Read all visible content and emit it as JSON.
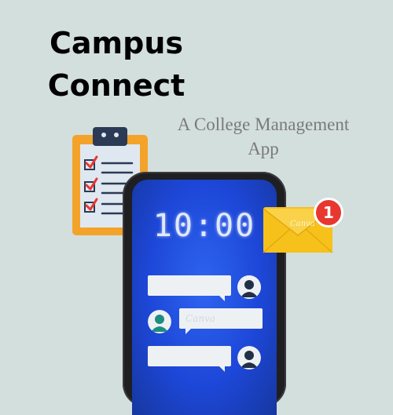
{
  "header": {
    "title_line1": "Campus",
    "title_line2": "Connect",
    "subtitle_line1": "A College Management",
    "subtitle_line2": "App"
  },
  "phone": {
    "clock": "10:00",
    "messages": [
      {
        "side": "right",
        "text": ""
      },
      {
        "side": "left",
        "text": "Canva"
      },
      {
        "side": "right",
        "text": ""
      }
    ]
  },
  "notification": {
    "badge_count": "1",
    "envelope_watermark": "Canva"
  },
  "colors": {
    "background": "#d3dfdd",
    "screen_blue": "#1d47d8",
    "clipboard_orange": "#f4a32a",
    "envelope_yellow": "#f7c11c",
    "badge_red": "#e8372f",
    "avatar_teal": "#1e8c80",
    "avatar_navy": "#213046"
  },
  "icons": [
    "clipboard-checklist-icon",
    "envelope-icon",
    "notification-badge",
    "user-avatar-icon"
  ]
}
